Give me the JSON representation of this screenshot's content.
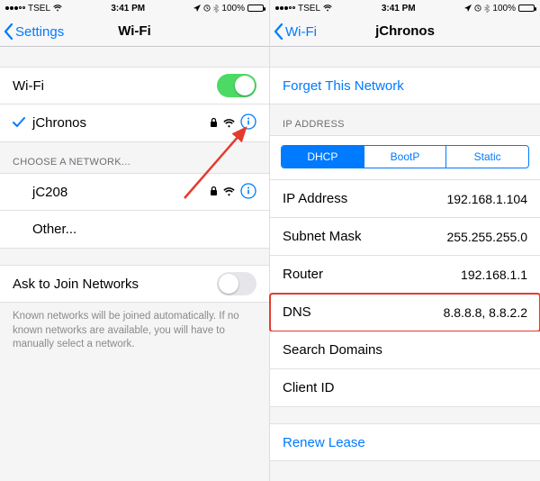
{
  "statusbar": {
    "carrier": "TSEL",
    "time": "3:41 PM",
    "battery": "100%"
  },
  "left": {
    "back": "Settings",
    "title": "Wi-Fi",
    "wifi_label": "Wi-Fi",
    "connected_network": "jChronos",
    "choose_header": "CHOOSE A NETWORK...",
    "other_network": "jC208",
    "other_label": "Other...",
    "ask_label": "Ask to Join Networks",
    "ask_note": "Known networks will be joined automatically. If no known networks are available, you will have to manually select a network."
  },
  "right": {
    "back": "Wi-Fi",
    "title": "jChronos",
    "forget": "Forget This Network",
    "ip_header": "IP ADDRESS",
    "seg": {
      "dhcp": "DHCP",
      "bootp": "BootP",
      "static": "Static"
    },
    "ip_label": "IP Address",
    "ip_value": "192.168.1.104",
    "subnet_label": "Subnet Mask",
    "subnet_value": "255.255.255.0",
    "router_label": "Router",
    "router_value": "192.168.1.1",
    "dns_label": "DNS",
    "dns_value": "8.8.8.8, 8.8.2.2",
    "search_label": "Search Domains",
    "client_label": "Client ID",
    "renew": "Renew Lease"
  }
}
